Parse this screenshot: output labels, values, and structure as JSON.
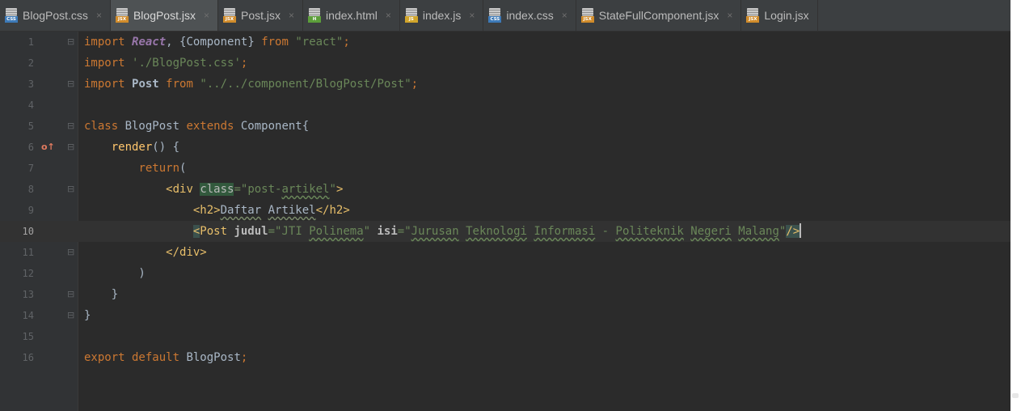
{
  "tabs": [
    {
      "label": "BlogPost.css",
      "kind": "CSS",
      "color": "#3d7ab8",
      "active": false,
      "closable": true
    },
    {
      "label": "BlogPost.jsx",
      "kind": "JSX",
      "color": "#d18c2b",
      "active": true,
      "closable": true
    },
    {
      "label": "Post.jsx",
      "kind": "JSX",
      "color": "#d18c2b",
      "active": false,
      "closable": true
    },
    {
      "label": "index.html",
      "kind": "H",
      "color": "#5c9e3a",
      "active": false,
      "closable": true
    },
    {
      "label": "index.js",
      "kind": "JS",
      "color": "#d1a52b",
      "active": false,
      "closable": true
    },
    {
      "label": "index.css",
      "kind": "CSS",
      "color": "#3d7ab8",
      "active": false,
      "closable": true
    },
    {
      "label": "StateFullComponent.jsx",
      "kind": "JSX",
      "color": "#d18c2b",
      "active": false,
      "closable": true
    },
    {
      "label": "Login.jsx",
      "kind": "JSX",
      "color": "#d18c2b",
      "active": false,
      "closable": false
    }
  ],
  "close_glyph": "×",
  "editor": {
    "current_line": 10,
    "lines": [
      {
        "n": "1",
        "fold": "⊟",
        "tokens": [
          [
            "kw",
            "import "
          ],
          [
            "it",
            "React"
          ],
          [
            "dflt",
            ", {Component} "
          ],
          [
            "kw",
            "from "
          ],
          [
            "str",
            "\"react\""
          ],
          [
            "kw",
            ";"
          ]
        ]
      },
      {
        "n": "2",
        "fold": "",
        "tokens": [
          [
            "kw",
            "import "
          ],
          [
            "str",
            "'./BlogPost.css'"
          ],
          [
            "kw",
            ";"
          ]
        ]
      },
      {
        "n": "3",
        "fold": "⊟",
        "tokens": [
          [
            "kw",
            "import "
          ],
          [
            "dflt bold",
            "Post "
          ],
          [
            "kw",
            "from "
          ],
          [
            "str",
            "\"../../component/BlogPost/Post\""
          ],
          [
            "kw",
            ";"
          ]
        ]
      },
      {
        "n": "4",
        "fold": "",
        "tokens": []
      },
      {
        "n": "5",
        "fold": "⊟",
        "tokens": [
          [
            "kw",
            "class "
          ],
          [
            "dflt",
            "BlogPost "
          ],
          [
            "kw",
            "extends "
          ],
          [
            "dflt",
            "Component{"
          ]
        ]
      },
      {
        "n": "6",
        "fold": "⊟",
        "override": "o↑",
        "tokens": [
          [
            "dflt",
            "    "
          ],
          [
            "fn",
            "render"
          ],
          [
            "dflt",
            "() {"
          ]
        ]
      },
      {
        "n": "7",
        "fold": "",
        "tokens": [
          [
            "dflt",
            "        "
          ],
          [
            "kw",
            "return"
          ],
          [
            "dflt",
            "("
          ]
        ]
      },
      {
        "n": "8",
        "fold": "⊟",
        "tokens": [
          [
            "dflt",
            "            "
          ],
          [
            "tagn",
            "<div "
          ],
          [
            "attr hl",
            "class"
          ],
          [
            "str",
            "=\"post-"
          ],
          [
            "str sq",
            "artikel"
          ],
          [
            "str",
            "\""
          ],
          [
            "tagn",
            ">"
          ]
        ]
      },
      {
        "n": "9",
        "fold": "",
        "tokens": [
          [
            "dflt",
            "                "
          ],
          [
            "tagn",
            "<h2>"
          ],
          [
            "dflt sq2",
            "Daftar"
          ],
          [
            "dflt",
            " "
          ],
          [
            "dflt sq2",
            "Artikel"
          ],
          [
            "tagn",
            "</h2>"
          ]
        ]
      },
      {
        "n": "10",
        "fold": "",
        "tokens": [
          [
            "dflt",
            "                "
          ],
          [
            "tagn caret",
            "<"
          ],
          [
            "tagn",
            "Post "
          ],
          [
            "attr bold",
            "judul"
          ],
          [
            "str",
            "=\"JTI "
          ],
          [
            "str sq",
            "Polinema"
          ],
          [
            "str",
            "\" "
          ],
          [
            "attr bold",
            "isi"
          ],
          [
            "str",
            "=\""
          ],
          [
            "str sq",
            "Jurusan"
          ],
          [
            "str",
            " "
          ],
          [
            "str sq",
            "Teknologi"
          ],
          [
            "str",
            " "
          ],
          [
            "str sq",
            "Informasi"
          ],
          [
            "str",
            " - "
          ],
          [
            "str sq",
            "Politeknik"
          ],
          [
            "str",
            " "
          ],
          [
            "str sq",
            "Negeri"
          ],
          [
            "str",
            " "
          ],
          [
            "str sq",
            "Malang"
          ],
          [
            "str",
            "\""
          ],
          [
            "tagn caret",
            "/>"
          ]
        ]
      },
      {
        "n": "11",
        "fold": "⊟",
        "tokens": [
          [
            "dflt",
            "            "
          ],
          [
            "tagn",
            "</div>"
          ]
        ]
      },
      {
        "n": "12",
        "fold": "",
        "tokens": [
          [
            "dflt",
            "        )"
          ]
        ]
      },
      {
        "n": "13",
        "fold": "⊟",
        "tokens": [
          [
            "dflt",
            "    }"
          ]
        ]
      },
      {
        "n": "14",
        "fold": "⊟",
        "tokens": [
          [
            "dflt",
            "}"
          ]
        ]
      },
      {
        "n": "15",
        "fold": "",
        "tokens": []
      },
      {
        "n": "16",
        "fold": "",
        "tokens": [
          [
            "kw",
            "export default "
          ],
          [
            "dflt",
            "BlogPost"
          ],
          [
            "kw",
            ";"
          ]
        ]
      }
    ]
  }
}
